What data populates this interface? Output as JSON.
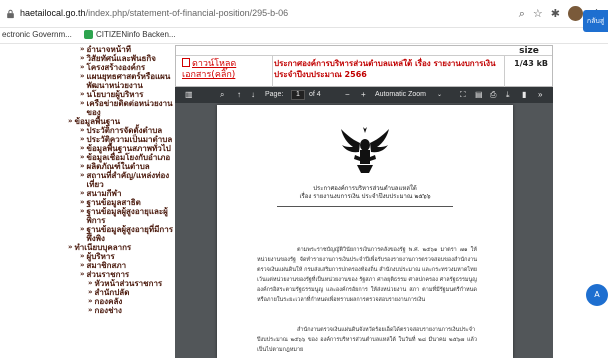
{
  "browser": {
    "url_host": "haetailocal.go.th",
    "url_path": "/index.php/statement-of-financial-position/295-b-06",
    "bookmarks": [
      "ectronic Governm...",
      "CITIZENinfo Backen..."
    ]
  },
  "sidebar": {
    "items": [
      {
        "label": "อำนาจหน้าที่",
        "level": 1
      },
      {
        "label": "วิสัยทัศน์และพันธกิจ",
        "level": 1
      },
      {
        "label": "โครงสร้างองค์กร",
        "level": 1
      },
      {
        "label": "แผนยุทธศาสตร์หรือแผนพัฒนาหน่วยงาน",
        "level": 1
      },
      {
        "label": "นโยบายผู้บริหาร",
        "level": 1
      },
      {
        "label": "เครือข่ายติดต่อหน่วยงานของ",
        "level": 1
      },
      {
        "label": "ข้อมูลพื้นฐาน",
        "level": 2
      },
      {
        "label": "ประวัติการจัดตั้งตำบล",
        "level": 3
      },
      {
        "label": "ประวัติความเป็นมาตำบล",
        "level": 3
      },
      {
        "label": "ข้อมูลพื้นฐานสภาพทั่วไป",
        "level": 3
      },
      {
        "label": "ข้อมูลเชื่อมโยงกับอำเภอ",
        "level": 3
      },
      {
        "label": "ผลิตภัณฑ์ในตำบล",
        "level": 3
      },
      {
        "label": "สถานที่สำคัญ/แหล่งท่องเที่ยว",
        "level": 3
      },
      {
        "label": "สนามกีฬา",
        "level": 3
      },
      {
        "label": "ฐานข้อมูลสาธิต",
        "level": 3
      },
      {
        "label": "ฐานข้อมูลผู้สูงอายุและผู้พิการ",
        "level": 3
      },
      {
        "label": "ฐานข้อมูลผู้สูงอายุที่มีการพึ่งพิง",
        "level": 3
      },
      {
        "label": "ทำเนียบบุคลากร",
        "level": 2
      },
      {
        "label": "ผู้บริหาร",
        "level": 3
      },
      {
        "label": "สมาชิกสภา",
        "level": 3
      },
      {
        "label": "ส่วนราชการ",
        "level": 3
      },
      {
        "label": "หัวหน้าส่วนราชการ",
        "level": 4
      },
      {
        "label": "สำนักปลัด",
        "level": 4
      },
      {
        "label": "กองคลัง",
        "level": 4
      },
      {
        "label": "กองช่าง",
        "level": 4
      }
    ]
  },
  "file_table": {
    "size_header": "size",
    "file_name": "ดาวน์โหลดเอกสาร(คลิ๊ก)",
    "description": "ประกาศองค์การบริหารส่วนตำบลแหล่ใต้ เรื่อง รายงานงบการเงิน ประจำปีงบประมาณ 2566",
    "size": "1/43 kB"
  },
  "pdf_viewer": {
    "page_label": "Page:",
    "page_current": "1",
    "page_total": "of 4",
    "zoom": "Automatic Zoom",
    "doc_title_line1": "ประกาศองค์การบริหารส่วนตำบลแหล่ใต้",
    "doc_title_line2": "เรื่อง  รายงานงบการเงิน ประจำปีงบประมาณ ๒๕๖๖",
    "para1": "ตามพระราชบัญญัติวินัยการเงินการคลังของรัฐ พ.ศ. ๒๕๖๑ มาตรา ๗๑ ให้หน่วยงานของรัฐ จัดทำรายงานการเงินประจำปีเพื่อรับรองรายงานการตรวจสอบของสำนักงานตรวจเงินแผ่นดินให้ กรมส่งเสริมการปกครองท้องถิ่น สำนักงบประมาณ และกระทรวงมหาดไทย เว้นแต่หน่วยงานของรัฐที่เป็นหน่วยงานของ รัฐสภา ศาลยุติธรรม ศาลปกครอง ศาลรัฐธรรมนูญ องค์กรอิสระตามรัฐธรรมนูญ และองค์กรอัยการ ให้ส่งหน่วยงาน สภา ตามที่มีรัฐมนตรีกำหนด หรือภายในระยะเวลาที่กำหนดเพื่อทราบผลการตรวจสอบรายงานการเงิน",
    "para2": "สำนักงานตรวจเงินแผ่นดินจังหวัดร้อยเอ็ดได้ตรวจสอบรายงานการเงินประจำปีงบประมาณ ๒๕๖๖ ของ องค์การบริหารส่วนตำบลแหล่ใต้ ในวันที่ ๒๘ มีนาคม ๒๕๖๗ แล้วเป็นไปตามกฎหมาย"
  },
  "side_buttons": {
    "top_right": "กลับสู่",
    "chat": "A"
  },
  "colors": {
    "menu_text": "#4b1a0d",
    "file_red": "#d10000",
    "pdf_toolbar": "#323639",
    "pdf_bg": "#525659",
    "accent_blue": "#1e6fd0"
  }
}
